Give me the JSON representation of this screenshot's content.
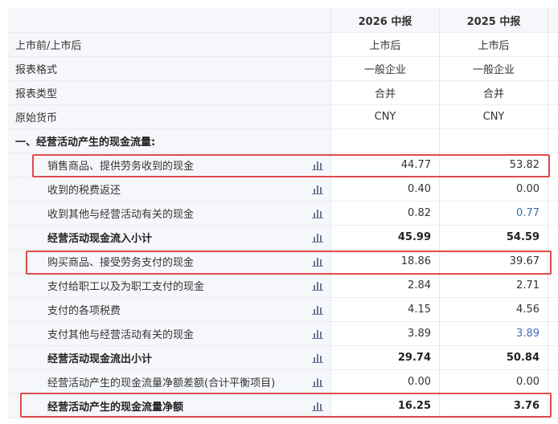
{
  "columns": {
    "y1": "2026 中报",
    "y2": "2025 中报"
  },
  "meta_rows": [
    {
      "label": "上市前/上市后",
      "y1": "上市后",
      "y2": "上市后"
    },
    {
      "label": "报表格式",
      "y1": "一般企业",
      "y2": "一般企业"
    },
    {
      "label": "报表类型",
      "y1": "合并",
      "y2": "合并"
    },
    {
      "label": "原始货币",
      "y1": "CNY",
      "y2": "CNY"
    }
  ],
  "section_title": "一、经营活动产生的现金流量:",
  "rows": [
    {
      "label": "销售商品、提供劳务收到的现金",
      "y1": "44.77",
      "y2": "53.82",
      "bold": false
    },
    {
      "label": "收到的税费返还",
      "y1": "0.40",
      "y2": "0.00",
      "bold": false
    },
    {
      "label": "收到其他与经营活动有关的现金",
      "y1": "0.82",
      "y2": "0.77",
      "bold": false,
      "y2_color": "#3b6fb6"
    },
    {
      "label": "经营活动现金流入小计",
      "y1": "45.99",
      "y2": "54.59",
      "bold": true
    },
    {
      "label": "购买商品、接受劳务支付的现金",
      "y1": "18.86",
      "y2": "39.67",
      "bold": false
    },
    {
      "label": "支付给职工以及为职工支付的现金",
      "y1": "2.84",
      "y2": "2.71",
      "bold": false
    },
    {
      "label": "支付的各项税费",
      "y1": "4.15",
      "y2": "4.56",
      "bold": false
    },
    {
      "label": "支付其他与经营活动有关的现金",
      "y1": "3.89",
      "y2": "3.89",
      "bold": false,
      "y2_color": "#3b6fb6"
    },
    {
      "label": "经营活动现金流出小计",
      "y1": "29.74",
      "y2": "50.84",
      "bold": true
    },
    {
      "label": "经营活动产生的现金流量净额差额(合计平衡项目)",
      "y1": "0.00",
      "y2": "0.00",
      "bold": false
    },
    {
      "label": "经营活动产生的现金流量净额",
      "y1": "16.25",
      "y2": "3.76",
      "bold": true
    }
  ],
  "icons": {
    "row_chart": "bar-chart-icon"
  },
  "colors": {
    "highlight_box": "#e04b4b",
    "label_bg": "#f5f7fa",
    "link_value": "#3b6fb6",
    "icon": "#6b7a99"
  }
}
